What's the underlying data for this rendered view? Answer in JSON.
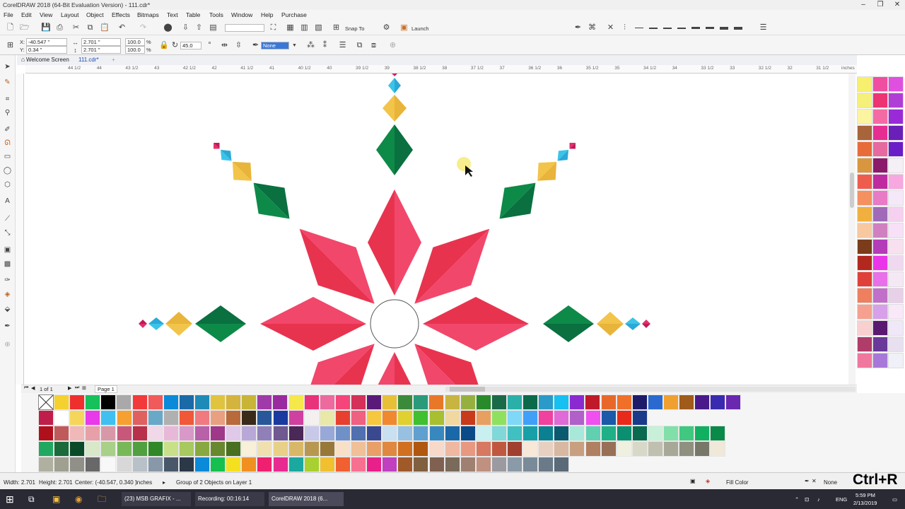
{
  "window": {
    "title": "CorelDRAW 2018 (64-Bit Evaluation Version) - 111.cdr*"
  },
  "menu": [
    "File",
    "Edit",
    "View",
    "Layout",
    "Object",
    "Effects",
    "Bitmaps",
    "Text",
    "Table",
    "Tools",
    "Window",
    "Help",
    "Purchase"
  ],
  "toolbar": {
    "snap_label": "Snap To",
    "launch_label": "Launch"
  },
  "properties": {
    "x": "-40.547 \"",
    "y": "0.34 \"",
    "w": "2.701 \"",
    "h": "2.701 \"",
    "scale_w": "100.0",
    "scale_h": "100.0",
    "pct": "%",
    "angle": "45.0",
    "outline": "None"
  },
  "tabs": {
    "welcome": "Welcome Screen",
    "doc": "111.cdr*",
    "add": "+"
  },
  "ruler": {
    "labels": [
      "44 1/2",
      "44",
      "43 1/2",
      "43",
      "42 1/2",
      "42",
      "41 1/2",
      "41",
      "40 1/2",
      "40",
      "39 1/2",
      "39",
      "38 1/2",
      "38",
      "37 1/2",
      "37",
      "36 1/2",
      "36",
      "35 1/2",
      "35",
      "34 1/2",
      "34",
      "33 1/2",
      "33",
      "32 1/2",
      "32",
      "31 1/2"
    ],
    "unit": "inches"
  },
  "pages": {
    "count": "1 of 1",
    "page": "Page 1"
  },
  "status": {
    "width": "Width: 2.701",
    "height": "Height: 2.701",
    "center": "Center: (-40.547, 0.340 )",
    "unit": "inches",
    "selection": "Group of 2 Objects on Layer 1",
    "fill": "Fill Color",
    "outline": "None"
  },
  "overlay": {
    "shortcut": "Ctrl+R"
  },
  "taskbar": {
    "items": [
      "(23) MSB GRAFIX - ...",
      "Recording: 00:16:14",
      "CorelDRAW 2018 (6..."
    ],
    "time": "5:59 PM",
    "date": "2/13/2019",
    "lang": "ENG"
  },
  "colors": {
    "palette_right": [
      "#f7ef6e",
      "#f04ea0",
      "#e050e0",
      "#f5f07a",
      "#ec3472",
      "#b03ed6",
      "#fbf4a0",
      "#f46aa4",
      "#9a2ad8",
      "#a8643a",
      "#e62e92",
      "#6a20b8",
      "#e86c3a",
      "#e66aa0",
      "#6a1ec8",
      "#d99640",
      "#8c1a6a",
      "#f5f0f5",
      "#ee5c4e",
      "#c02aa0",
      "#f7a8e0",
      "#f59060",
      "#e87ac6",
      "#f5e8f8",
      "#f0b040",
      "#a06ab8",
      "#f5d0f0",
      "#f8c8a0",
      "#d080c0",
      "#f8e0f8",
      "#7a3c1a",
      "#b43cb8",
      "#f8e0f0",
      "#b2281e",
      "#ea36e8",
      "#f0d8f0",
      "#e0403a",
      "#e870e8",
      "#f5e8f5",
      "#ee8060",
      "#c070c8",
      "#e8d0e8",
      "#f6a090",
      "#d8a0e8",
      "#f8e8f8",
      "#f8d0d0",
      "#5a1a70",
      "#f0e8f8",
      "#b03c6a",
      "#6a3a9a",
      "#e8e0f0",
      "#f0789e",
      "#a878d8",
      "#f0f0f8"
    ],
    "palette_rows": [
      [
        "#f5d130",
        "#ef2e2e",
        "#16c05a",
        "#000000",
        "#a9a9a9",
        "#f23a3a",
        "#f05a5a",
        "#0a8ad8",
        "#1a6aa8",
        "#1e8ab8",
        "#e0c440",
        "#d4b43c",
        "#c8b436",
        "#a03aa8",
        "#9a2aa0",
        "#f5e84a",
        "#e8327a",
        "#ec6a9e",
        "#f4467a",
        "#d4305a",
        "#5a1a7a",
        "#e8c038",
        "#3a8a3a",
        "#2a9a7a",
        "#e87828",
        "#c8b440",
        "#96b040",
        "#288a2a",
        "#1a6a4a",
        "#2ab0a8",
        "#0a6a4a",
        "#2a9ac8",
        "#16c0f0",
        "#8a2ad0",
        "#c01a2a",
        "#e8682a",
        "#f0702a",
        "#1e1a6a",
        "#2a6ad0",
        "#f0a030",
        "#a05a1a",
        "#4a1a8a",
        "#3a2ab0",
        "#6a28b0"
      ],
      [
        "#c01e4a",
        "#ffffff",
        "#f5d65a",
        "#e83ae8",
        "#40c0f0",
        "#f5a030",
        "#e06060",
        "#6aa8c8",
        "#b0b0b0",
        "#f05838",
        "#f07a80",
        "#e8a080",
        "#b86a3a",
        "#3a2a1a",
        "#28589a",
        "#1a3aa0",
        "#d040a0",
        "#f5f0f0",
        "#e8e8a8",
        "#e84030",
        "#f06080",
        "#f5c840",
        "#f08830",
        "#e0d030",
        "#40c030",
        "#a8c030",
        "#f0d8a0",
        "#c83a1a",
        "#e8a060",
        "#90e060",
        "#80d8f8",
        "#40a0f8",
        "#f040a0",
        "#e06ad8",
        "#b060c8",
        "#f050f0",
        "#1a5aa8",
        "#e82a1a",
        "#1a3a8a"
      ],
      [
        "#b0101c",
        "#c05a5a",
        "#f0b8b8",
        "#e8a0a8",
        "#d898a8",
        "#c8587a",
        "#b8304a",
        "#f0d8e8",
        "#e8b8d8",
        "#d898c8",
        "#b860a8",
        "#a0388a",
        "#e0c8e8",
        "#b8a8d8",
        "#9080b8",
        "#705890",
        "#4a2858",
        "#c8c8e8",
        "#98a8d8",
        "#7090c8",
        "#5070b0",
        "#3a4890",
        "#c8e0f0",
        "#98c0e0",
        "#60a0d0",
        "#3888c0",
        "#1a68a8",
        "#0a4a88",
        "#c8f0f0",
        "#80d8d8",
        "#40c0c0",
        "#18a0a8",
        "#0a8090",
        "#0a5a70",
        "#a8e8d8",
        "#60d0b0",
        "#20b088",
        "#0a9070",
        "#0a6a50",
        "#c8f0d8",
        "#80e0a8",
        "#40c880",
        "#10b060",
        "#0a8a48"
      ],
      [
        "#20a860",
        "#1a6a3a",
        "#0a4a28",
        "#d8e8c8",
        "#a8d088",
        "#78b858",
        "#50a040",
        "#308828",
        "#c8e088",
        "#a8c860",
        "#88a840",
        "#688830",
        "#487020",
        "#f8f0d8",
        "#f0e0b0",
        "#e8d088",
        "#d8b868",
        "#b89850",
        "#987838",
        "#f8e0c8",
        "#f0c098",
        "#e8a068",
        "#e08840",
        "#d07020",
        "#b05810",
        "#f8d8c8",
        "#f0b8a0",
        "#e89880",
        "#d87860",
        "#c05840",
        "#a04030",
        "#f8e8d8",
        "#e8d0c0",
        "#d8b8a0",
        "#c8a080",
        "#b08060",
        "#987058",
        "#f0f0e0",
        "#d8d8c8",
        "#c0c0b0",
        "#a8a898",
        "#909080",
        "#787868",
        "#f0e8d8"
      ],
      [
        "#b0b0a0",
        "#a0a090",
        "#909088",
        "#686868",
        "#f8f8f8",
        "#d8d8d8",
        "#b8c0c8",
        "#8898a8",
        "#485868",
        "#2a3848",
        "#0a8ad8",
        "#16c050",
        "#f5e020",
        "#f09020",
        "#f02070",
        "#e82a90",
        "#1aa8a0",
        "#a8d030",
        "#f0c030",
        "#f06030",
        "#f87090",
        "#e8208a",
        "#c040c0",
        "#a05a2a",
        "#806040",
        "#806050",
        "#7a6a5a",
        "#a08070",
        "#c09080",
        "#9a9aa0",
        "#8a9aa8",
        "#7a8a98",
        "#6a7a88",
        "#5a6a78"
      ]
    ],
    "star": {
      "red": "#e8334f",
      "pink": "#f1476b",
      "green": "#0e8a48",
      "yellow": "#f2c44a",
      "cyan": "#3cc4e8",
      "magenta": "#e0306a"
    }
  }
}
